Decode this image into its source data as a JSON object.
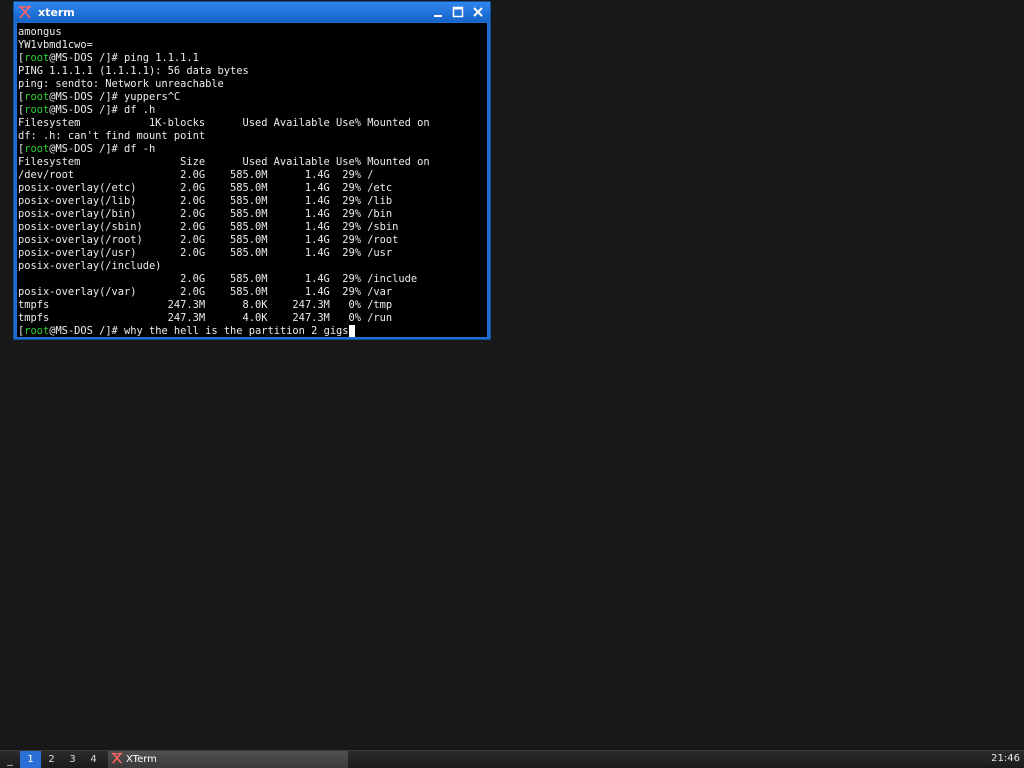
{
  "window": {
    "title": "xterm",
    "icon": "xterm-icon"
  },
  "terminal": {
    "prompt_user": "root",
    "prompt_host": "@MS-DOS /]# ",
    "lines": [
      {
        "type": "out",
        "text": "amongus"
      },
      {
        "type": "out",
        "text": "YW1vbmd1cwo="
      },
      {
        "type": "cmd",
        "text": "ping 1.1.1.1"
      },
      {
        "type": "out",
        "text": "PING 1.1.1.1 (1.1.1.1): 56 data bytes"
      },
      {
        "type": "out",
        "text": "ping: sendto: Network unreachable"
      },
      {
        "type": "cmd",
        "text": "yuppers^C"
      },
      {
        "type": "cmd",
        "text": "df .h"
      },
      {
        "type": "out",
        "text": "Filesystem           1K-blocks      Used Available Use% Mounted on"
      },
      {
        "type": "out",
        "text": "df: .h: can't find mount point"
      },
      {
        "type": "cmd",
        "text": "df -h"
      },
      {
        "type": "out",
        "text": "Filesystem                Size      Used Available Use% Mounted on"
      },
      {
        "type": "out",
        "text": "/dev/root                 2.0G    585.0M      1.4G  29% /"
      },
      {
        "type": "out",
        "text": "posix-overlay(/etc)       2.0G    585.0M      1.4G  29% /etc"
      },
      {
        "type": "out",
        "text": "posix-overlay(/lib)       2.0G    585.0M      1.4G  29% /lib"
      },
      {
        "type": "out",
        "text": "posix-overlay(/bin)       2.0G    585.0M      1.4G  29% /bin"
      },
      {
        "type": "out",
        "text": "posix-overlay(/sbin)      2.0G    585.0M      1.4G  29% /sbin"
      },
      {
        "type": "out",
        "text": "posix-overlay(/root)      2.0G    585.0M      1.4G  29% /root"
      },
      {
        "type": "out",
        "text": "posix-overlay(/usr)       2.0G    585.0M      1.4G  29% /usr"
      },
      {
        "type": "out",
        "text": "posix-overlay(/include)"
      },
      {
        "type": "out",
        "text": "                          2.0G    585.0M      1.4G  29% /include"
      },
      {
        "type": "out",
        "text": "posix-overlay(/var)       2.0G    585.0M      1.4G  29% /var"
      },
      {
        "type": "out",
        "text": "tmpfs                   247.3M      8.0K    247.3M   0% /tmp"
      },
      {
        "type": "out",
        "text": "tmpfs                   247.3M      4.0K    247.3M   0% /run"
      },
      {
        "type": "cmd",
        "text": "why the hell is the partition 2 gigs",
        "cursor": true
      }
    ]
  },
  "taskbar": {
    "menu_label": "_",
    "workspaces": [
      "1",
      "2",
      "3",
      "4"
    ],
    "active_workspace": 0,
    "task_label": "XTerm",
    "clock": "21:46"
  },
  "colors": {
    "titlebar": "#1f6fd0",
    "prompt_green": "#2fd02f",
    "terminal_bg": "#000000",
    "desktop_bg": "#181818"
  }
}
